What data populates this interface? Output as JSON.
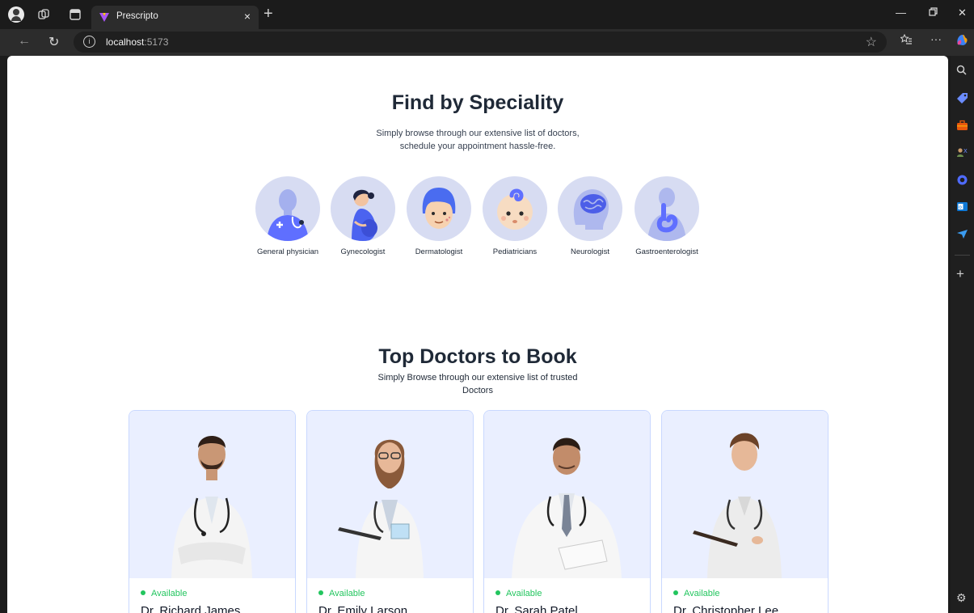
{
  "browser": {
    "tab_title": "Prescripto",
    "tab_close": "×",
    "new_tab": "+",
    "url_host": "localhost",
    "url_port": ":5173"
  },
  "page": {
    "speciality": {
      "title": "Find by Speciality",
      "line1": "Simply browse through our extensive list of doctors,",
      "line2": "schedule your appointment hassle-free.",
      "items": [
        {
          "label": "General physician",
          "icon": "general-physician-icon"
        },
        {
          "label": "Gynecologist",
          "icon": "gynecologist-icon"
        },
        {
          "label": "Dermatologist",
          "icon": "dermatologist-icon"
        },
        {
          "label": "Pediatricians",
          "icon": "pediatricians-icon"
        },
        {
          "label": "Neurologist",
          "icon": "neurologist-icon"
        },
        {
          "label": "Gastroenterologist",
          "icon": "gastroenterologist-icon"
        }
      ]
    },
    "top_doctors": {
      "title": "Top Doctors to Book",
      "line1": "Simply Browse through our extensive list of trusted",
      "line2": "Doctors",
      "doctors": [
        {
          "status": "Available",
          "name": "Dr. Richard James"
        },
        {
          "status": "Available",
          "name": "Dr. Emily Larson"
        },
        {
          "status": "Available",
          "name": "Dr. Sarah Patel"
        },
        {
          "status": "Available",
          "name": "Dr. Christopher Lee"
        }
      ]
    }
  },
  "colors": {
    "accent": "#5f6fff",
    "available": "#22c55e",
    "card_bg": "#eaefff",
    "icon_circle": "#d7dcf2"
  }
}
